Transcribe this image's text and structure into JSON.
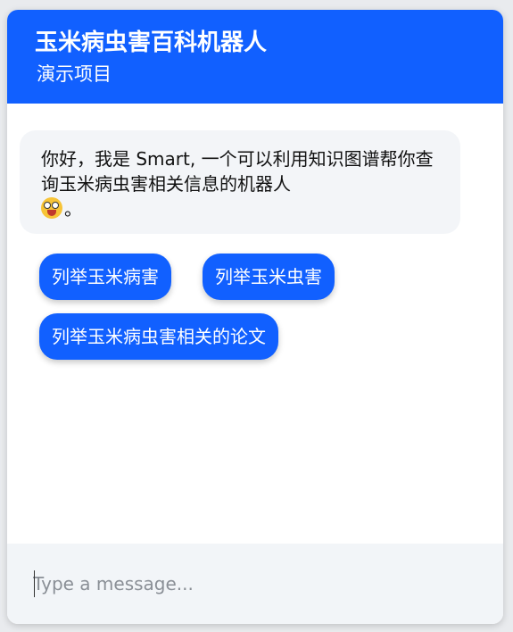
{
  "header": {
    "title": "玉米病虫害百科机器人",
    "subtitle": "演示项目"
  },
  "messages": [
    {
      "text": "你好，我是 Smart, 一个可以利用知识图谱帮你查询玉米病虫害相关信息的机器人",
      "emoji": "face-with-tongue-icon",
      "end": "。"
    }
  ],
  "quick_replies": [
    {
      "label": "列举玉米病害"
    },
    {
      "label": "列举玉米虫害"
    },
    {
      "label": "列举玉米病虫害相关的论文"
    }
  ],
  "composer": {
    "placeholder": "Type a message..."
  },
  "colors": {
    "accent": "#1160ff",
    "bubble_bg": "#f3f5f8",
    "composer_bg": "#f2f5f8"
  }
}
